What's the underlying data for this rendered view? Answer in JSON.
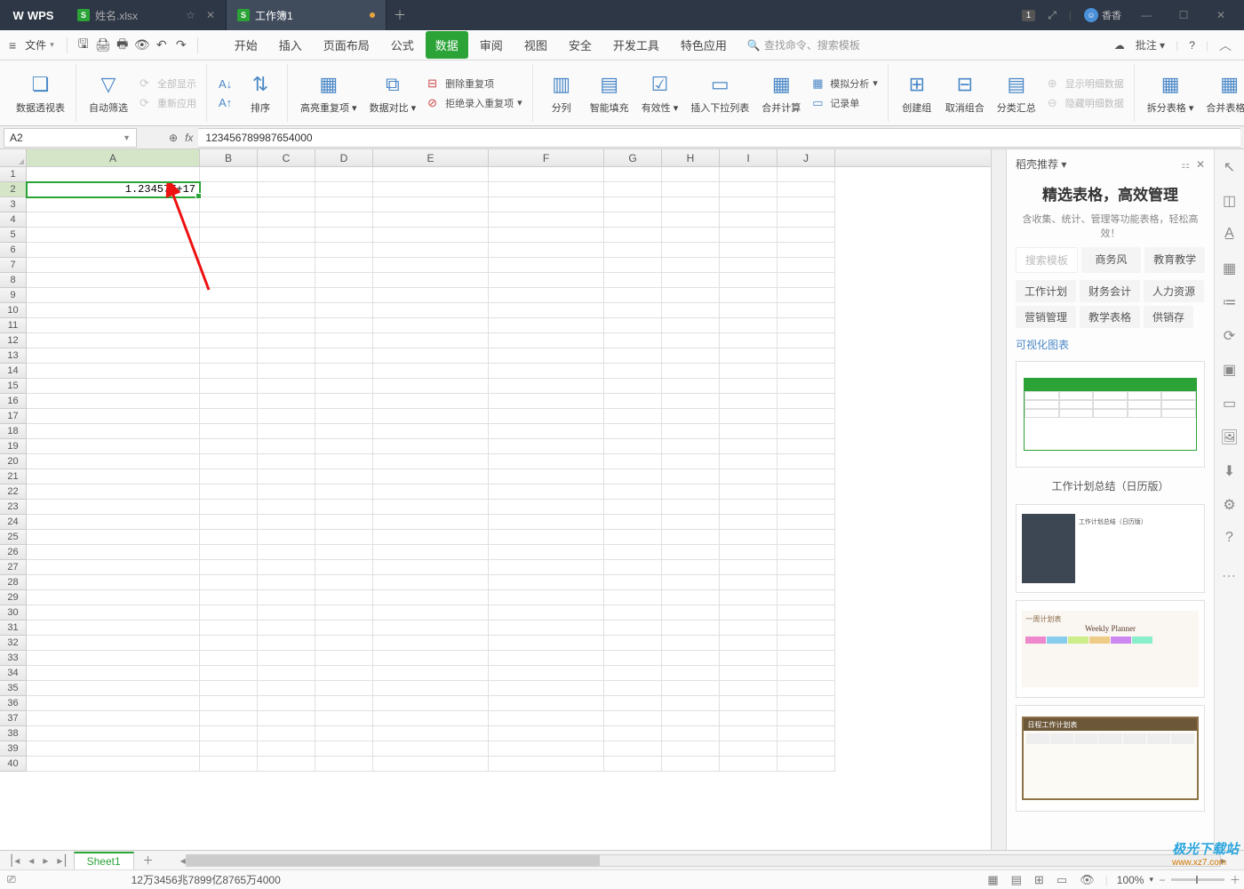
{
  "titlebar": {
    "logo": "WPS",
    "tab1": "姓名.xlsx",
    "tab2": "工作簿1",
    "notif_count": "1",
    "user_name": "香香"
  },
  "menubar": {
    "file": "文件",
    "items": [
      "开始",
      "插入",
      "页面布局",
      "公式",
      "数据",
      "审阅",
      "视图",
      "安全",
      "开发工具",
      "特色应用"
    ],
    "active_index": 4,
    "search_placeholder": "查找命令、搜索模板",
    "annotate": "批注"
  },
  "ribbon": {
    "pivot": "数据透视表",
    "autofilter": "自动筛选",
    "showall": "全部显示",
    "reapply": "重新应用",
    "sort_asc": "↓",
    "sort": "排序",
    "highlight_dup": "高亮重复项",
    "data_compare": "数据对比",
    "del_dup": "删除重复项",
    "reject_dup": "拒绝录入重复项",
    "text_to_cols": "分列",
    "smart_fill": "智能填充",
    "validation": "有效性",
    "insert_dropdown": "插入下拉列表",
    "consolidate": "合并计算",
    "what_if": "模拟分析",
    "record_form": "记录单",
    "group": "创建组",
    "ungroup": "取消组合",
    "subtotal": "分类汇总",
    "show_detail": "显示明细数据",
    "hide_detail": "隐藏明细数据",
    "split_table": "拆分表格",
    "merge_table": "合并表格"
  },
  "formula": {
    "cell_ref": "A2",
    "fx": "fx",
    "value": "123456789987654000"
  },
  "grid": {
    "columns": [
      "A",
      "B",
      "C",
      "D",
      "E",
      "F",
      "G",
      "H",
      "I",
      "J"
    ],
    "row_count": 40,
    "selected_cell": "A2",
    "cell_A2": "1.23457E+17"
  },
  "side_panel": {
    "header": "稻壳推荐",
    "title": "精选表格，高效管理",
    "subtitle": "含收集、统计、管理等功能表格，轻松高效！",
    "search_ph": "搜索模板",
    "tabs": [
      "商务风",
      "教育教学"
    ],
    "cats": [
      "工作计划",
      "财务会计",
      "人力资源",
      "营销管理",
      "教学表格",
      "供销存"
    ],
    "viz_link": "可视化图表",
    "tmpl2_title": "工作计划总结（日历版）",
    "tmpl3_label": "一周计划表",
    "tmpl3_sub": "Weekly  Planner",
    "tmpl4_label": "日程工作计划表"
  },
  "sheet_tabs": {
    "sheet1": "Sheet1"
  },
  "status": {
    "long_num": "12万3456兆7899亿8765万4000",
    "zoom": "100%"
  },
  "watermark": {
    "line1": "极光下载站",
    "line2": "www.xz7.com"
  }
}
